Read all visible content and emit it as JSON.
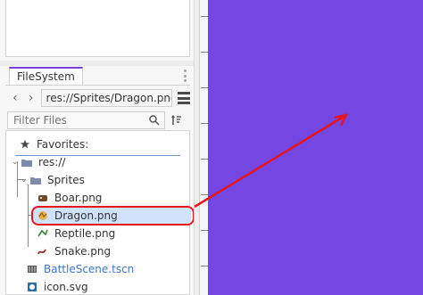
{
  "filesystem": {
    "tab_label": "FileSystem",
    "path_value": "res://Sprites/Dragon.png",
    "filter_placeholder": "Filter Files",
    "favorites_label": "Favorites:",
    "root_label": "res://",
    "sprites_folder_label": "Sprites",
    "files": [
      "Boar.png",
      "Dragon.png",
      "Reptile.png",
      "Snake.png"
    ],
    "battle_scene_label": "BattleScene.tscn",
    "icon_label": "icon.svg"
  },
  "ruler": {
    "labels": [
      "",
      "",
      "",
      "",
      ""
    ]
  },
  "colors": {
    "canvas": "#7447e2",
    "annotation": "#e6161f",
    "selection": "#cfe3ff",
    "accent_tab": "#7a3fe0"
  },
  "icons": {
    "back": "chevron-left-icon",
    "forward": "chevron-right-icon",
    "layout": "layout-toggle-icon",
    "search": "search-icon",
    "sort": "sort-icon",
    "favorites": "star-icon",
    "folder": "folder-icon",
    "file": "image-file-icon"
  }
}
